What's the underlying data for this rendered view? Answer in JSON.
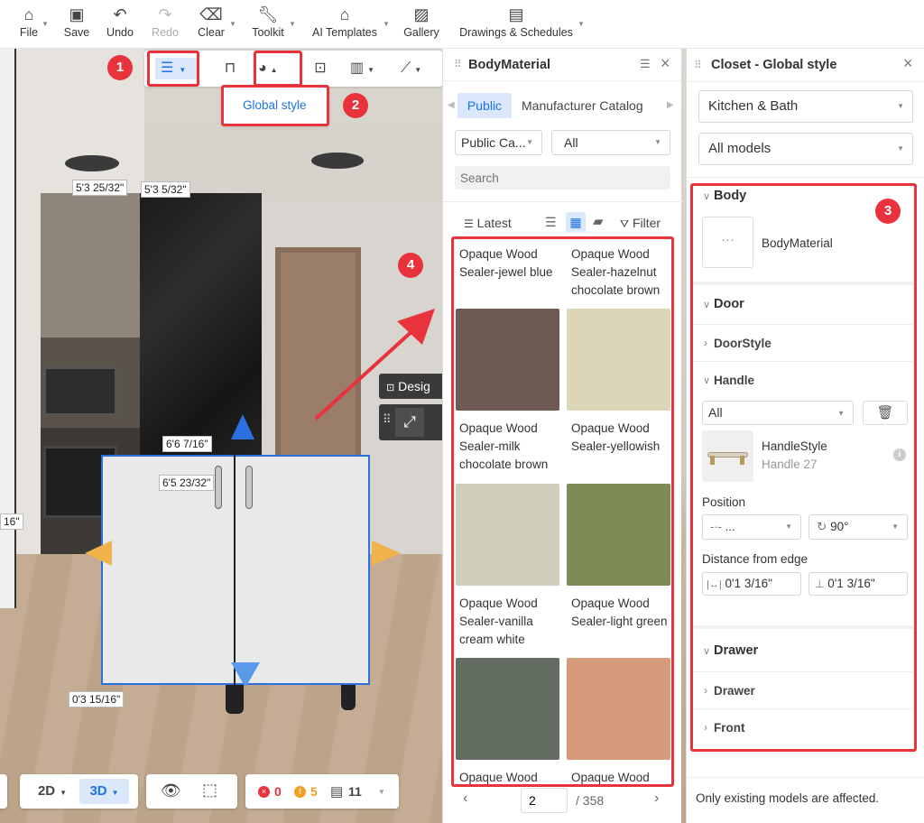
{
  "toolbar": {
    "items": [
      {
        "label": "File",
        "icon": "home-icon"
      },
      {
        "label": "Save",
        "icon": "save-icon"
      },
      {
        "label": "Undo",
        "icon": "undo-icon"
      },
      {
        "label": "Redo",
        "icon": "redo-icon"
      },
      {
        "label": "Clear",
        "icon": "eraser-icon"
      },
      {
        "label": "Toolkit",
        "icon": "wrench-icon"
      },
      {
        "label": "AI Templates",
        "icon": "ai-house-icon"
      },
      {
        "label": "Gallery",
        "icon": "image-icon"
      },
      {
        "label": "Drawings & Schedules",
        "icon": "document-icon"
      }
    ]
  },
  "global_style_menu": {
    "label": "Global style"
  },
  "badges": [
    "1",
    "2",
    "3",
    "4"
  ],
  "viewport": {
    "dimensions": [
      "5'3 25/32\"",
      "5'3 5/32\"",
      "6'6 7/16\"",
      "6'5 23/32\"",
      "0'3 15/16\"",
      "16\""
    ],
    "design_label": "Desig"
  },
  "material_panel": {
    "title": "BodyMaterial",
    "tabs": [
      "Public",
      "Manufacturer Catalog"
    ],
    "catalog_select": "Public Ca...",
    "filter_select": "All",
    "search_placeholder": "Search",
    "sort_label": "Latest",
    "filter_label": "Filter",
    "materials": [
      {
        "name": "Opaque Wood Sealer-jewel blue",
        "color": null
      },
      {
        "name": "Opaque Wood Sealer-hazelnut chocolate brown",
        "color": null
      },
      {
        "name": "Opaque Wood Sealer-milk chocolate brown",
        "color": "#6e5a52"
      },
      {
        "name": "Opaque Wood Sealer-yellowish",
        "color": "#dcd6b8"
      },
      {
        "name": "Opaque Wood Sealer-vanilla cream white",
        "color": "#cfcebc"
      },
      {
        "name": "Opaque Wood Sealer-light green",
        "color": "#7f8b57"
      },
      {
        "name": "Opaque Wood",
        "color": "#636c60"
      },
      {
        "name": "Opaque Wood",
        "color": "#d69a7c"
      }
    ],
    "page": "2",
    "total_pages": "/ 358"
  },
  "closet_panel": {
    "title": "Closet - Global style",
    "category_select": "Kitchen & Bath",
    "models_select": "All models",
    "body": {
      "title": "Body",
      "material_name": "BodyMaterial",
      "placeholder": "···"
    },
    "door": {
      "title": "Door",
      "door_style": "DoorStyle",
      "handle": "Handle"
    },
    "handle": {
      "filter": "All",
      "style_name": "HandleStyle",
      "style_sub": "Handle 27"
    },
    "position": {
      "label": "Position",
      "value1": "...",
      "value2": "90°"
    },
    "distance": {
      "label": "Distance from edge",
      "value1": "0'1 3/16\"",
      "value2": "0'1 3/16\""
    },
    "drawer": {
      "title": "Drawer",
      "drawer": "Drawer",
      "front": "Front"
    },
    "footer": "Only existing models are affected."
  },
  "bottom_bar": {
    "mode_2d": "2D",
    "mode_3d": "3D",
    "errors": "0",
    "warnings": "5",
    "items": "11"
  },
  "colors": {
    "accent": "#1a73e8",
    "highlight": "#e8333c",
    "active_bg": "#dbe8fb"
  }
}
